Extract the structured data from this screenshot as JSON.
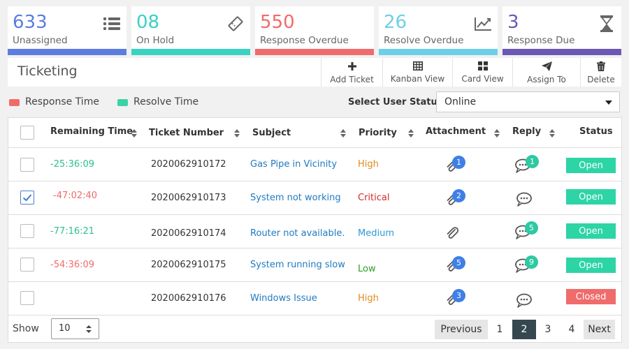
{
  "kpis": [
    {
      "value": "633",
      "label": "Unassigned",
      "icon": "list-icon",
      "color": "#5b7de0"
    },
    {
      "value": "08",
      "label": "On Hold",
      "icon": "ticket-icon",
      "color": "#3ad2c2"
    },
    {
      "value": "550",
      "label": "Response Overdue",
      "icon": "",
      "color": "#f06b6b"
    },
    {
      "value": "26",
      "label": "Resolve Overdue",
      "icon": "trend-chart-icon",
      "color": "#6dd0e8"
    },
    {
      "value": "3",
      "label": "Response Due",
      "icon": "hourglass-icon",
      "color": "#6a58b4"
    }
  ],
  "toolbar": {
    "title": "Ticketing",
    "buttons": [
      {
        "label": "Add Ticket",
        "icon": "plus-icon"
      },
      {
        "label": "Kanban View",
        "icon": "table-grid-icon"
      },
      {
        "label": "Card View",
        "icon": "card-grid-icon"
      },
      {
        "label": "Assign To",
        "icon": "paper-plane-icon"
      },
      {
        "label": "Delete",
        "icon": "trash-icon"
      }
    ]
  },
  "legend": {
    "response": {
      "label": "Response Time",
      "color": "#f06b6b"
    },
    "resolve": {
      "label": "Resolve Time",
      "color": "#3ad2a7"
    }
  },
  "user_status": {
    "label": "Select User Status:",
    "value": "Online"
  },
  "table": {
    "headers": [
      "Remaining Time",
      "Ticket Number",
      "Subject",
      "Priority",
      "Attachment",
      "Reply",
      "Status"
    ],
    "rows": [
      {
        "checked": false,
        "time": "-25:36:09",
        "time_color": "#2bbf8f",
        "ticket": "2020062910172",
        "subject": "Gas Pipe in Vicinity",
        "priority": "High",
        "priority_color": "#e08a1e",
        "attachments": "1",
        "replies": "1",
        "status": "Open",
        "status_color": "#2dd4a6"
      },
      {
        "checked": true,
        "time": "-47:02:40",
        "time_color": "#f06b6b",
        "ticket": "2020062910173",
        "subject": "System not working",
        "priority": "Critical",
        "priority_color": "#d42a2a",
        "attachments": "2",
        "replies": "",
        "status": "Open",
        "status_color": "#2dd4a6"
      },
      {
        "checked": false,
        "time": "-77:16:21",
        "time_color": "#2bbf8f",
        "ticket": "2020062910174",
        "subject": "Router not available.",
        "priority": "Medium",
        "priority_color": "#2d9ad6",
        "attachments": "",
        "replies": "5",
        "status": "Open",
        "status_color": "#2dd4a6"
      },
      {
        "checked": false,
        "time": "-54:36:09",
        "time_color": "#f06b6b",
        "ticket": "2020062910175",
        "subject": "System running slow",
        "priority": "Low",
        "priority_color": "#2aa11f",
        "attachments": "5",
        "replies": "9",
        "status": "Open",
        "status_color": "#2dd4a6"
      },
      {
        "checked": false,
        "time": "",
        "time_color": "#333333",
        "ticket": "2020062910176",
        "subject": "Windows Issue",
        "priority": "High",
        "priority_color": "#e08a1e",
        "attachments": "3",
        "replies": "",
        "status": "Closed",
        "status_color": "#f06b6b"
      }
    ]
  },
  "footer": {
    "show_label": "Show",
    "page_size": "10",
    "pagination": [
      "Previous",
      "1",
      "2",
      "3",
      "4",
      "Next"
    ],
    "active_page": "2"
  },
  "colors": {
    "subject_link": "#1f7ac1",
    "badge_blue": "#3f7fe8",
    "badge_teal": "#2dc9a2"
  }
}
